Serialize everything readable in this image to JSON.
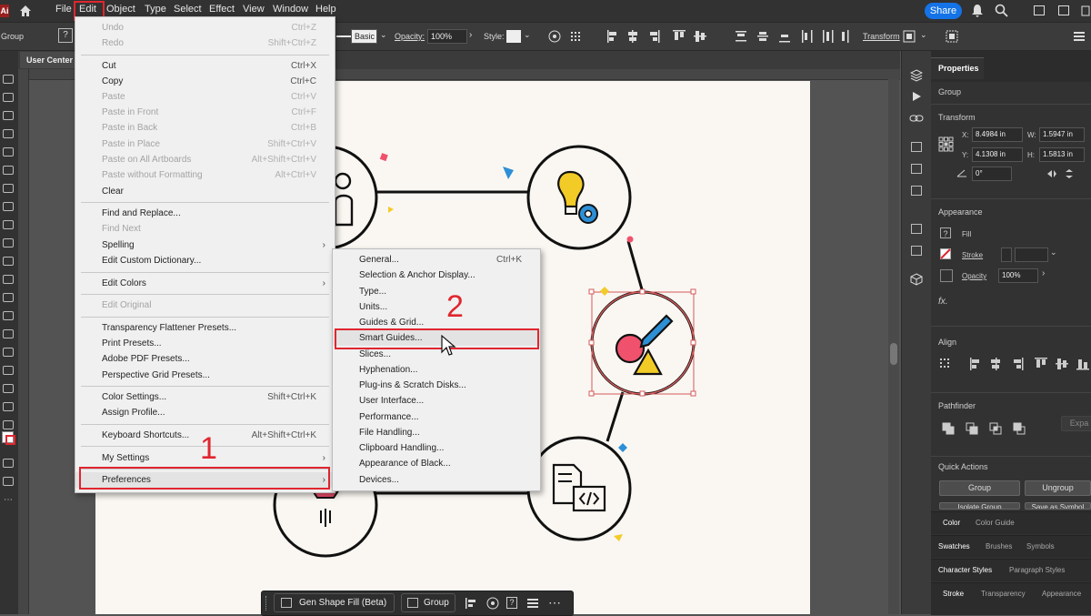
{
  "app": {
    "logo_text": "Ai"
  },
  "menubar": {
    "items": [
      "File",
      "Edit",
      "Object",
      "Type",
      "Select",
      "Effect",
      "View",
      "Window",
      "Help"
    ],
    "share_label": "Share"
  },
  "control_bar": {
    "object_type": "Group",
    "stroke_style": "Basic",
    "opacity_label": "Opacity:",
    "opacity_value": "100%",
    "style_label": "Style:",
    "transform_label": "Transform"
  },
  "document_tab": "User Center",
  "edit_menu": {
    "items": [
      {
        "label": "Undo",
        "shortcut": "Ctrl+Z",
        "disabled": true
      },
      {
        "label": "Redo",
        "shortcut": "Shift+Ctrl+Z",
        "disabled": true
      },
      {
        "label": "Cut",
        "shortcut": "Ctrl+X",
        "disabled": false
      },
      {
        "label": "Copy",
        "shortcut": "Ctrl+C",
        "disabled": false
      },
      {
        "label": "Paste",
        "shortcut": "Ctrl+V",
        "disabled": true
      },
      {
        "label": "Paste in Front",
        "shortcut": "Ctrl+F",
        "disabled": true
      },
      {
        "label": "Paste in Back",
        "shortcut": "Ctrl+B",
        "disabled": true
      },
      {
        "label": "Paste in Place",
        "shortcut": "Shift+Ctrl+V",
        "disabled": true
      },
      {
        "label": "Paste on All Artboards",
        "shortcut": "Alt+Shift+Ctrl+V",
        "disabled": true
      },
      {
        "label": "Paste without Formatting",
        "shortcut": "Alt+Ctrl+V",
        "disabled": true
      },
      {
        "label": "Clear",
        "shortcut": "",
        "disabled": false
      },
      {
        "label": "Find and Replace...",
        "shortcut": "",
        "disabled": false
      },
      {
        "label": "Find Next",
        "shortcut": "",
        "disabled": true
      },
      {
        "label": "Spelling",
        "shortcut": "",
        "disabled": false,
        "submenu": true
      },
      {
        "label": "Edit Custom Dictionary...",
        "shortcut": "",
        "disabled": false
      },
      {
        "label": "Edit Colors",
        "shortcut": "",
        "disabled": false,
        "submenu": true
      },
      {
        "label": "Edit Original",
        "shortcut": "",
        "disabled": true
      },
      {
        "label": "Transparency Flattener Presets...",
        "shortcut": "",
        "disabled": false
      },
      {
        "label": "Print Presets...",
        "shortcut": "",
        "disabled": false
      },
      {
        "label": "Adobe PDF Presets...",
        "shortcut": "",
        "disabled": false
      },
      {
        "label": "Perspective Grid Presets...",
        "shortcut": "",
        "disabled": false
      },
      {
        "label": "Color Settings...",
        "shortcut": "Shift+Ctrl+K",
        "disabled": false
      },
      {
        "label": "Assign Profile...",
        "shortcut": "",
        "disabled": false
      },
      {
        "label": "Keyboard Shortcuts...",
        "shortcut": "Alt+Shift+Ctrl+K",
        "disabled": false
      },
      {
        "label": "My Settings",
        "shortcut": "",
        "disabled": false,
        "submenu": true
      },
      {
        "label": "Preferences",
        "shortcut": "",
        "disabled": false,
        "submenu": true
      }
    ]
  },
  "preferences_submenu": {
    "items": [
      {
        "label": "General...",
        "shortcut": "Ctrl+K"
      },
      {
        "label": "Selection & Anchor Display...",
        "shortcut": ""
      },
      {
        "label": "Type...",
        "shortcut": ""
      },
      {
        "label": "Units...",
        "shortcut": ""
      },
      {
        "label": "Guides & Grid...",
        "shortcut": ""
      },
      {
        "label": "Smart Guides...",
        "shortcut": ""
      },
      {
        "label": "Slices...",
        "shortcut": ""
      },
      {
        "label": "Hyphenation...",
        "shortcut": ""
      },
      {
        "label": "Plug-ins & Scratch Disks...",
        "shortcut": ""
      },
      {
        "label": "User Interface...",
        "shortcut": ""
      },
      {
        "label": "Performance...",
        "shortcut": ""
      },
      {
        "label": "File Handling...",
        "shortcut": ""
      },
      {
        "label": "Clipboard Handling...",
        "shortcut": ""
      },
      {
        "label": "Appearance of Black...",
        "shortcut": ""
      },
      {
        "label": "Devices...",
        "shortcut": ""
      }
    ]
  },
  "annotations": {
    "step1": "1",
    "step2": "2"
  },
  "properties_panel": {
    "title": "Properties",
    "object_type": "Group",
    "transform_title": "Transform",
    "x_label": "X:",
    "x_value": "8.4984 in",
    "y_label": "Y:",
    "y_value": "4.1308 in",
    "w_label": "W:",
    "w_value": "1.5947 in",
    "h_label": "H:",
    "h_value": "1.5813 in",
    "angle_value": "0°",
    "appearance_title": "Appearance",
    "fill_label": "Fill",
    "stroke_label": "Stroke",
    "opacity_label": "Opacity",
    "opacity_value": "100%",
    "fx_label": "fx.",
    "align_title": "Align",
    "pathfinder_title": "Pathfinder",
    "expand_label": "Expa",
    "quick_actions_title": "Quick Actions",
    "group_button": "Group",
    "ungroup_button": "Ungroup",
    "isolate_button": "Isolate Group",
    "save_symbol_button": "Save as Symbol"
  },
  "panel_tabs": {
    "row1": [
      "Color",
      "Color Guide"
    ],
    "row2": [
      "Swatches",
      "Brushes",
      "Symbols"
    ],
    "row3": [
      "Character Styles",
      "Paragraph Styles"
    ],
    "row4": [
      "Stroke",
      "Transparency",
      "Appearance"
    ]
  },
  "bottom_bar": {
    "gen_fill_label": "Gen Shape Fill (Beta)",
    "group_label": "Group"
  },
  "colors": {
    "highlight_red": "#e0262f",
    "accent_blue": "#1473e6",
    "selection_red": "#d45a5a",
    "icon_yellow": "#f3cb27",
    "icon_blue": "#2d8fd6",
    "icon_pink": "#f0516c"
  }
}
